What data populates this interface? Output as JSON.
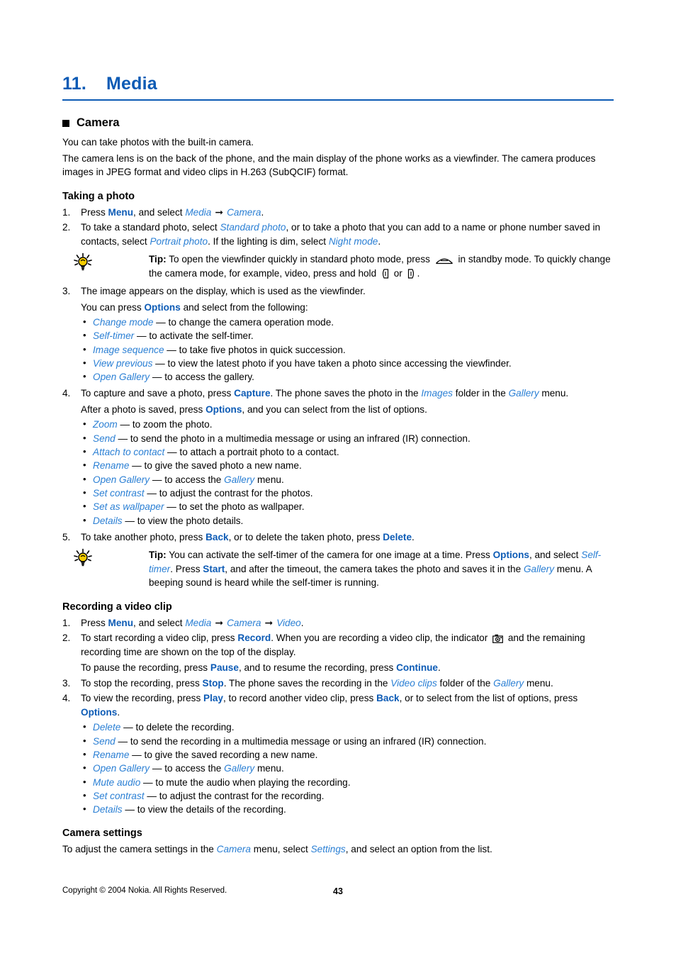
{
  "chapter": {
    "number": "11.",
    "title": "Media"
  },
  "camera_section": {
    "heading": "Camera",
    "intro1": "You can take photos with the built-in camera.",
    "intro2": "The camera lens is on the back of the phone, and the main display of the phone works as a viewfinder. The camera produces images in JPEG format and video clips in H.263 (SubQCIF) format."
  },
  "taking_photo": {
    "heading": "Taking a photo",
    "step1": {
      "pre": "Press ",
      "cmd": "Menu",
      "mid": ", and select ",
      "menu1": "Media",
      "menu2": "Camera",
      "end": "."
    },
    "step2": {
      "pre": "To take a standard photo, select ",
      "menu1": "Standard photo",
      "mid1": ", or to take a photo that you can add to a name or phone number saved in contacts, select ",
      "menu2": "Portrait photo",
      "mid2": ". If the lighting is dim, select ",
      "menu3": "Night mode",
      "end": "."
    },
    "tip1": {
      "label": "Tip:",
      "part1": " To open the viewfinder quickly in standard photo mode, press ",
      "icon1": "scroll-up-key-icon",
      "part2": " in standby mode. To quickly change the camera mode, for example, video, press and hold ",
      "icon2": "left-scroll-key-icon",
      "part3": " or ",
      "icon3": "right-scroll-key-icon",
      "part4": "."
    },
    "step3": {
      "text": "The image appears on the display, which is used as the viewfinder.",
      "sub_pre": "You can press ",
      "sub_cmd": "Options",
      "sub_post": " and select from the following:"
    },
    "viewfinder_options": [
      {
        "name": "Change mode",
        "desc": " — to change the camera operation mode."
      },
      {
        "name": "Self-timer",
        "desc": " — to activate the self-timer."
      },
      {
        "name": "Image sequence",
        "desc": " — to take five photos in quick succession."
      },
      {
        "name": "View previous",
        "desc": " — to view the latest photo if you have taken a photo since accessing the viewfinder."
      },
      {
        "name": "Open Gallery",
        "desc": " — to access the gallery."
      }
    ],
    "step4": {
      "pre": "To capture and save a photo, press ",
      "cmd": "Capture",
      "mid1": ". The phone saves the photo in the ",
      "menu1": "Images",
      "mid2": " folder in the ",
      "menu2": "Gallery",
      "end": " menu.",
      "sub_pre": "After a photo is saved, press ",
      "sub_cmd": "Options",
      "sub_post": ", and you can select from the list of options."
    },
    "saved_photo_options": [
      {
        "name": "Zoom",
        "desc": " — to zoom the photo."
      },
      {
        "name": "Send",
        "desc": " — to send the photo in a multimedia message or using an infrared (IR) connection."
      },
      {
        "name": "Attach to contact",
        "desc": " — to attach a portrait photo to a contact."
      },
      {
        "name": "Rename",
        "desc": " — to give the saved photo a new name."
      },
      {
        "name": "Open Gallery",
        "desc": " — to access the ",
        "menu": "Gallery",
        "desc2": " menu."
      },
      {
        "name": "Set contrast",
        "desc": " — to adjust the contrast for the photos."
      },
      {
        "name": "Set as wallpaper",
        "desc": " — to set the photo as wallpaper."
      },
      {
        "name": "Details",
        "desc": " — to view the photo details."
      }
    ],
    "step5": {
      "pre": "To take another photo, press ",
      "cmd1": "Back",
      "mid": ", or to delete the taken photo, press ",
      "cmd2": "Delete",
      "end": "."
    },
    "tip2": {
      "label": "Tip:",
      "part1": " You can activate the self-timer of the camera for one image at a time. Press ",
      "cmd1": "Options",
      "part2": ", and select ",
      "menu1": "Self-timer",
      "part3": ". Press ",
      "cmd2": "Start",
      "part4": ", and after the timeout, the camera takes the photo and saves it in the ",
      "menu2": "Gallery",
      "part5": " menu. A beeping sound is heard while the self-timer is running."
    }
  },
  "recording_video": {
    "heading": "Recording a video clip",
    "step1": {
      "pre": "Press ",
      "cmd": "Menu",
      "mid": ", and select ",
      "menu1": "Media",
      "menu2": "Camera",
      "menu3": "Video",
      "end": "."
    },
    "step2": {
      "pre": "To start recording a video clip, press ",
      "cmd": "Record",
      "mid1": ". When you are recording a video clip, the indicator ",
      "icon": "camera-indicator-icon",
      "mid2": " and the remaining recording time are shown on the top of the display.",
      "sub_pre": "To pause the recording, press ",
      "sub_cmd1": "Pause",
      "sub_mid": ", and to resume the recording, press ",
      "sub_cmd2": "Continue",
      "sub_end": "."
    },
    "step3": {
      "pre": "To stop the recording, press ",
      "cmd": "Stop",
      "mid1": ". The phone saves the recording in the ",
      "menu1": "Video clips",
      "mid2": " folder of the ",
      "menu2": "Gallery",
      "end": " menu."
    },
    "step4": {
      "pre": "To view the recording, press ",
      "cmd1": "Play",
      "mid1": ", to record another video clip, press ",
      "cmd2": "Back",
      "mid2": ", or to select from the list of options, press ",
      "cmd3": "Options",
      "end": "."
    },
    "recording_options": [
      {
        "name": "Delete",
        "desc": " — to delete the recording."
      },
      {
        "name": "Send",
        "desc": " — to send the recording in a multimedia message or using an infrared (IR) connection."
      },
      {
        "name": "Rename",
        "desc": " — to give the saved recording a new name."
      },
      {
        "name": "Open Gallery",
        "desc": " — to access the ",
        "menu": "Gallery",
        "desc2": " menu."
      },
      {
        "name": "Mute audio",
        "desc": " — to mute the audio when playing the recording."
      },
      {
        "name": "Set contrast",
        "desc": " — to adjust the contrast for the recording."
      },
      {
        "name": "Details",
        "desc": " — to view the details of the recording."
      }
    ]
  },
  "camera_settings": {
    "heading": "Camera settings",
    "pre": "To adjust the camera settings in the ",
    "menu1": "Camera",
    "mid": " menu, select ",
    "menu2": "Settings",
    "end": ", and select an option from the list."
  },
  "footer": {
    "copyright": "Copyright © 2004 Nokia. All Rights Reserved.",
    "page": "43"
  },
  "colors": {
    "heading_blue": "#0d5bb5",
    "menu_blue": "#2a7fd4",
    "bulb_yellow": "#f5cc00"
  }
}
